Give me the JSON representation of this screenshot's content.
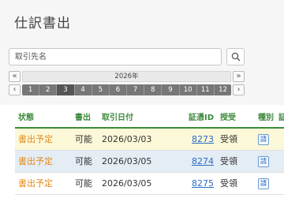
{
  "page": {
    "title": "仕訳書出"
  },
  "search": {
    "placeholder": "取引先名",
    "button_icon": "search-icon"
  },
  "calendar": {
    "prev_year_label": "«",
    "next_year_label": "»",
    "prev_month_label": "‹",
    "next_month_label": "›",
    "year_label": "2026年",
    "months": [
      "1",
      "2",
      "3",
      "4",
      "5",
      "6",
      "7",
      "8",
      "9",
      "10",
      "11",
      "12"
    ],
    "selected_month": "3"
  },
  "table": {
    "headers": [
      "状態",
      "書出",
      "取引日付",
      "証憑ID",
      "授受",
      "種別",
      "証憑"
    ],
    "rows": [
      {
        "status": "書出予定",
        "export": "可能",
        "date": "2026/03/03",
        "id": "8273",
        "receipt": "受領",
        "kind": "請"
      },
      {
        "status": "書出予定",
        "export": "可能",
        "date": "2026/03/05",
        "id": "8274",
        "receipt": "受領",
        "kind": "請"
      },
      {
        "status": "書出予定",
        "export": "可能",
        "date": "2026/03/05",
        "id": "8275",
        "receipt": "受領",
        "kind": "請"
      }
    ]
  },
  "colors": {
    "accent_green": "#3c8a3c",
    "status_orange": "#e38a1e",
    "link_blue": "#2a6ac8"
  }
}
